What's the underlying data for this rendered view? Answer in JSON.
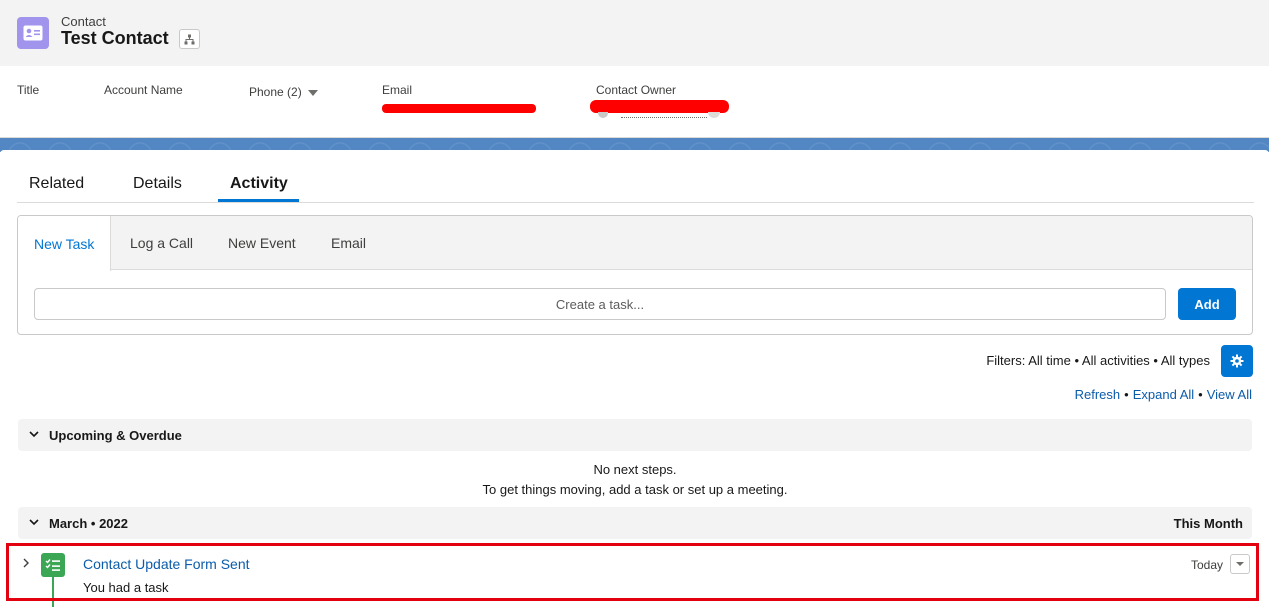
{
  "header": {
    "object_type": "Contact",
    "record_name": "Test Contact",
    "icon_color": "#a094ed"
  },
  "highlights": {
    "title_label": "Title",
    "account_label": "Account Name",
    "phone_label": "Phone (2)",
    "email_label": "Email",
    "owner_label": "Contact Owner"
  },
  "tabs": [
    {
      "label": "Related",
      "active": false
    },
    {
      "label": "Details",
      "active": false
    },
    {
      "label": "Activity",
      "active": true
    }
  ],
  "composer": {
    "tabs": [
      "New Task",
      "Log a Call",
      "New Event",
      "Email"
    ],
    "placeholder": "Create a task...",
    "add_label": "Add"
  },
  "filters": {
    "text": "Filters: All time • All activities • All types"
  },
  "links": {
    "refresh": "Refresh",
    "expand_all": "Expand All",
    "view_all": "View All"
  },
  "upcoming": {
    "title": "Upcoming & Overdue",
    "empty_line1": "No next steps.",
    "empty_line2": "To get things moving, add a task or set up a meeting."
  },
  "month_section": {
    "title": "March • 2022",
    "right_label": "This Month"
  },
  "activity_item": {
    "title": "Contact Update Form Sent",
    "subtitle": "You had a task",
    "date": "Today",
    "icon_color": "#3ba755"
  },
  "colors": {
    "brand": "#0176d3",
    "link": "#0b5cab",
    "highlight_border": "#e3000f",
    "redaction": "#ff0000"
  }
}
